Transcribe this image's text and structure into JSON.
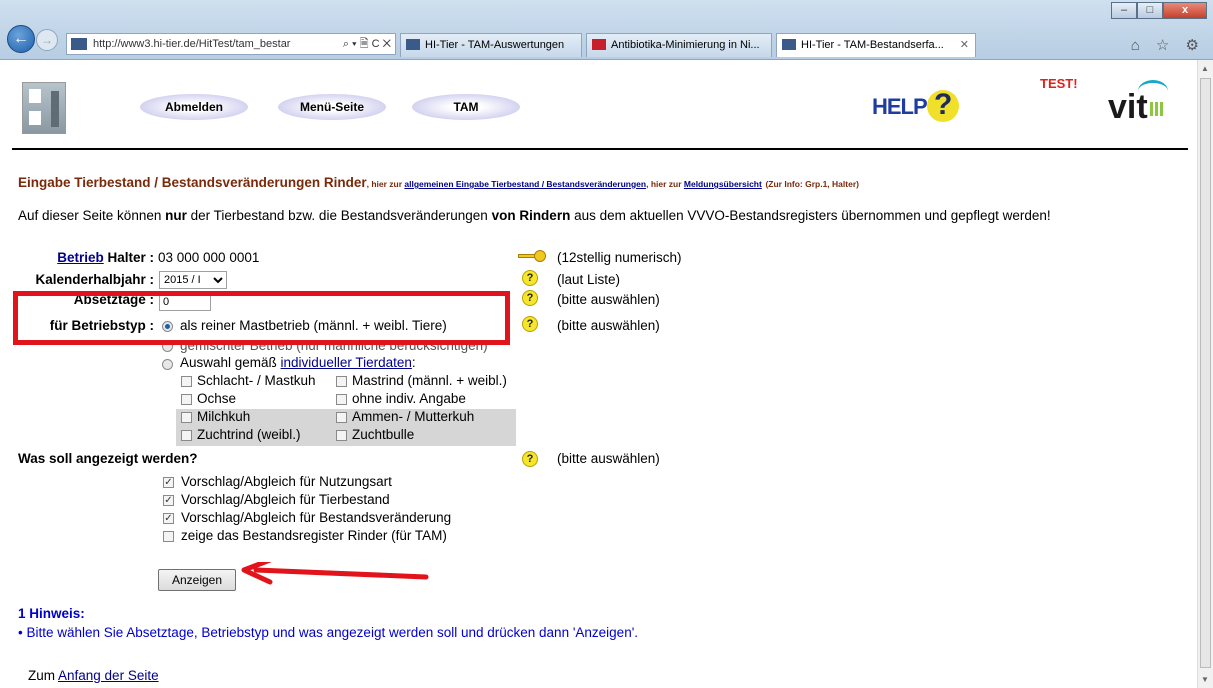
{
  "browser": {
    "url": "http://www3.hi-tier.de/HitTest/tam_bestar",
    "url_controls": "⌕ ▾ 🗎 C ✕",
    "tabs": [
      {
        "label": "HI-Tier - TAM-Auswertungen",
        "active": false
      },
      {
        "label": "Antibiotika-Minimierung in Ni...",
        "active": false
      },
      {
        "label": "HI-Tier - TAM-Bestandserfa...",
        "active": true
      }
    ],
    "tab_close": "✕",
    "tools": "⌂ ☆ ⚙"
  },
  "header": {
    "nav": [
      "Abmelden",
      "Menü-Seite",
      "TAM"
    ],
    "help_text": "HELP",
    "help_mark": "?",
    "test_label": "TEST!",
    "brand": "vit"
  },
  "heading": {
    "title": "Eingabe Tierbestand / Bestandsveränderungen Rinder",
    "pre1": ", hier zur ",
    "link1": "allgemeinen Eingabe Tierbestand / Bestandsveränderungen",
    "pre2": ", hier zur ",
    "link2": "Meldungsübersicht",
    "info": "(Zur Info: Grp.1, Halter)"
  },
  "intro": {
    "t1": "Auf dieser Seite können ",
    "b1": "nur",
    "t2": " der Tierbestand bzw. die Bestandsveränderungen ",
    "b2": "von Rindern",
    "t3": " aus dem aktuellen VVVO-Bestandsregisters übernommen und gepflegt werden!"
  },
  "form": {
    "betrieb_link": "Betrieb",
    "betrieb_label": " Halter :",
    "betrieb_value": "03 000 000 0001",
    "betrieb_hint": "(12stellig numerisch)",
    "kalender_label": "Kalenderhalbjahr :",
    "kalender_value": "2015 / I",
    "kalender_hint": "(laut Liste)",
    "absetz_label": "Absetztage :",
    "absetz_value": "0",
    "absetz_hint": "(bitte auswählen)",
    "typ_label": "für Betriebstyp :",
    "typ_hint": "(bitte auswählen)",
    "typ_options": {
      "mast": "als reiner Mastbetrieb (männl. + weibl. Tiere)",
      "gemischt": "gemischter Betrieb (nur männliche berücksichtigen)",
      "auswahl_pre": "Auswahl gemäß ",
      "auswahl_link": "individueller Tierdaten",
      "auswahl_post": ":"
    },
    "individual": [
      "Schlacht- / Mastkuh",
      "Mastrind (männl. + weibl.)",
      "Ochse",
      "ohne indiv. Angabe",
      "Milchkuh",
      "Ammen- / Mutterkuh",
      "Zuchtrind (weibl.)",
      "Zuchtbulle"
    ],
    "show_label": "Was soll angezeigt werden?",
    "show_hint": "(bitte auswählen)",
    "show_options": [
      {
        "label": "Vorschlag/Abgleich für Nutzungsart",
        "checked": true
      },
      {
        "label": "Vorschlag/Abgleich für Tierbestand",
        "checked": true
      },
      {
        "label": "Vorschlag/Abgleich für Bestandsveränderung",
        "checked": true
      },
      {
        "label": "zeige das Bestandsregister Rinder (für TAM)",
        "checked": false
      }
    ],
    "submit": "Anzeigen"
  },
  "notice": {
    "title": "1 Hinweis:",
    "text": "• Bitte wählen Sie Absetztage, Betriebstyp und was angezeigt werden soll und drücken dann 'Anzeigen'."
  },
  "footer": {
    "pre": "Zum ",
    "link": "Anfang der Seite"
  },
  "q_mark": "?",
  "check_mark": "✓",
  "colors": {
    "highlight": "#e0141a",
    "heading": "#7a2a0a",
    "notice": "#0000cc"
  }
}
